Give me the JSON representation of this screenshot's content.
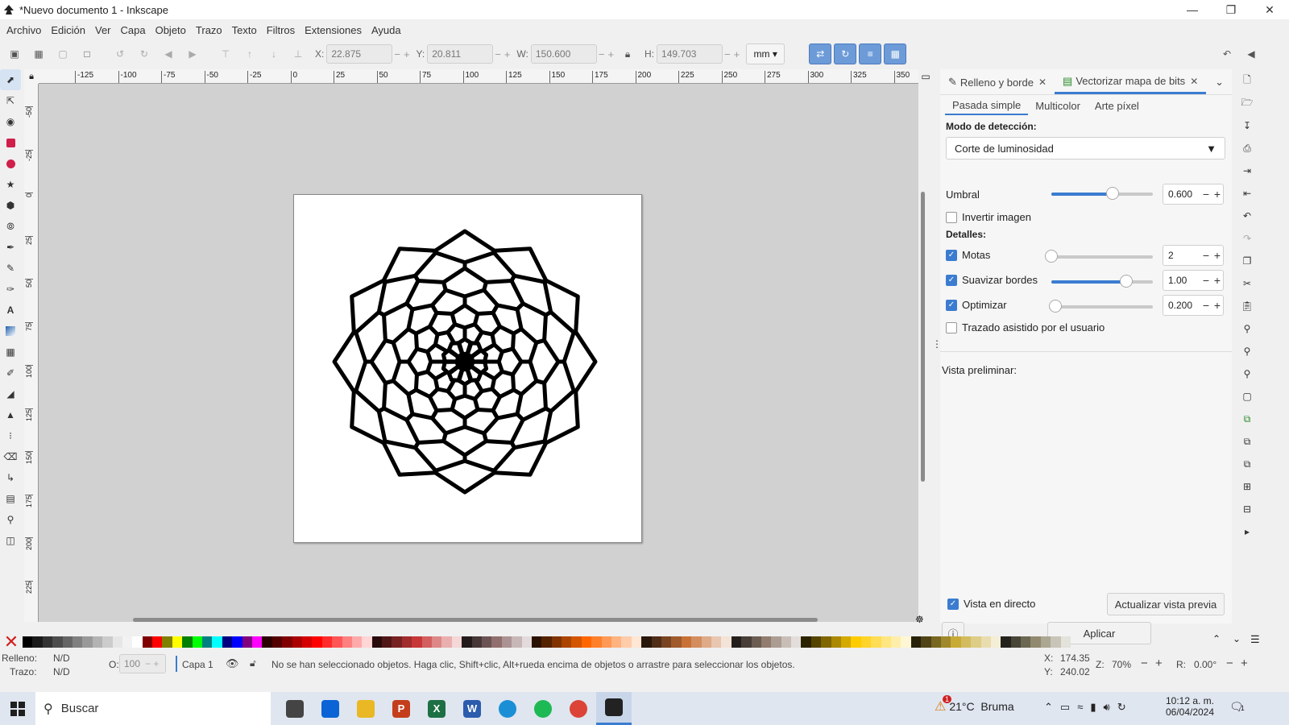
{
  "window": {
    "title": "*Nuevo documento 1 - Inkscape"
  },
  "menu": [
    "Archivo",
    "Edición",
    "Ver",
    "Capa",
    "Objeto",
    "Trazo",
    "Texto",
    "Filtros",
    "Extensiones",
    "Ayuda"
  ],
  "toolbar": {
    "x_label": "X:",
    "x_value": "22.875",
    "y_label": "Y:",
    "y_value": "20.811",
    "w_label": "W:",
    "w_value": "150.600",
    "h_label": "H:",
    "h_value": "149.703",
    "unit": "mm"
  },
  "ruler": {
    "h_ticks": [
      "-125",
      "-100",
      "-75",
      "-50",
      "-25",
      "0",
      "25",
      "50",
      "75",
      "100",
      "125",
      "150",
      "175",
      "200",
      "225",
      "250",
      "275",
      "300",
      "325",
      "350"
    ],
    "v_ticks": [
      "-50",
      "-25",
      "0",
      "25",
      "50",
      "75",
      "100",
      "125",
      "150",
      "175",
      "200",
      "225"
    ]
  },
  "dock": {
    "tabs": [
      {
        "label": "Relleno y borde",
        "icon": "fill-stroke-icon"
      },
      {
        "label": "Vectorizar mapa de bits",
        "icon": "trace-bitmap-icon"
      }
    ],
    "subtabs": [
      "Pasada simple",
      "Multicolor",
      "Arte píxel"
    ],
    "mode_label": "Modo de detección:",
    "mode_value": "Corte de luminosidad",
    "threshold": {
      "label": "Umbral",
      "value": "0.600",
      "level": 0.6
    },
    "invert": {
      "label": "Invertir imagen",
      "checked": false
    },
    "details_label": "Detalles:",
    "details": [
      {
        "label": "Motas",
        "value": "2",
        "checked": true,
        "level": 0.0
      },
      {
        "label": "Suavizar bordes",
        "value": "1.00",
        "checked": true,
        "level": 0.74
      },
      {
        "label": "Optimizar",
        "value": "0.200",
        "checked": true,
        "level": 0.04
      }
    ],
    "user_assisted": {
      "label": "Trazado asistido por el usuario",
      "checked": false
    },
    "preview_label": "Vista preliminar:",
    "live_preview": {
      "label": "Vista en directo",
      "checked": true
    },
    "update_preview": "Actualizar vista previa",
    "apply": "Aplicar"
  },
  "status": {
    "fill_label": "Relleno:",
    "fill_value": "N/D",
    "stroke_label": "Trazo:",
    "stroke_value": "N/D",
    "opacity_label": "O:",
    "opacity_value": "100",
    "layer": "Capa 1",
    "message": "No se han seleccionado objetos. Haga clic, Shift+clic, Alt+rueda encima de objetos o arrastre para seleccionar los objetos.",
    "cursor_x_label": "X:",
    "cursor_x": "174.35",
    "cursor_y_label": "Y:",
    "cursor_y": "240.02",
    "zoom_label": "Z:",
    "zoom": "70%",
    "rotation_label": "R:",
    "rotation": "0.00°"
  },
  "taskbar": {
    "search": "Buscar",
    "weather": "21°C  Bruma",
    "weather_badge": "1",
    "time": "10:12 a. m.",
    "date": "06/04/2024",
    "notif_count": "1",
    "apps": [
      {
        "name": "task-view",
        "letter": "",
        "color": "#444"
      },
      {
        "name": "mail",
        "letter": "",
        "color": "#0a64d6"
      },
      {
        "name": "file-explorer",
        "letter": "",
        "color": "#e9b824"
      },
      {
        "name": "powerpoint",
        "letter": "P",
        "color": "#c43e1c"
      },
      {
        "name": "excel",
        "letter": "X",
        "color": "#1d7044"
      },
      {
        "name": "word",
        "letter": "W",
        "color": "#2b5cad"
      },
      {
        "name": "edge",
        "letter": "",
        "color": "#1a8fd6"
      },
      {
        "name": "spotify",
        "letter": "",
        "color": "#1db954"
      },
      {
        "name": "chrome",
        "letter": "",
        "color": "#db4437"
      },
      {
        "name": "inkscape",
        "letter": "",
        "color": "#222"
      }
    ]
  },
  "palette": [
    "#000000",
    "#1a1a1a",
    "#333333",
    "#4d4d4d",
    "#666666",
    "#808080",
    "#999999",
    "#b3b3b3",
    "#cccccc",
    "#e6e6e6",
    "#f2f2f2",
    "#ffffff",
    "#800000",
    "#ff0000",
    "#808000",
    "#ffff00",
    "#008000",
    "#00ff00",
    "#008080",
    "#00ffff",
    "#000080",
    "#0000ff",
    "#800080",
    "#ff00ff",
    "#2b0000",
    "#550000",
    "#800000",
    "#aa0000",
    "#d40000",
    "#ff0000",
    "#ff2a2a",
    "#ff5555",
    "#ff8080",
    "#ffaaaa",
    "#ffd5d5",
    "#280b0b",
    "#501616",
    "#782121",
    "#a02c2c",
    "#c83737",
    "#d35f5f",
    "#de8787",
    "#e9afaf",
    "#f4d7d7",
    "#241c1c",
    "#483737",
    "#6c5353",
    "#916f6f",
    "#ac9393",
    "#c8b7b7",
    "#e3dbdb",
    "#2b1100",
    "#552200",
    "#803300",
    "#aa4400",
    "#d45500",
    "#ff6600",
    "#ff7f2a",
    "#ff9955",
    "#ffb380",
    "#ffccaa",
    "#ffe6d5",
    "#28170b",
    "#502d16",
    "#784421",
    "#a05a2c",
    "#c87137",
    "#d38d5f",
    "#deaa87",
    "#e9c6af",
    "#f4e3d7",
    "#241f1c",
    "#483e37",
    "#6c5d53",
    "#917c6f",
    "#ac9d93",
    "#c8beb7",
    "#e3dedb",
    "#2b2200",
    "#554400",
    "#806600",
    "#aa8800",
    "#d4aa00",
    "#ffcc00",
    "#ffd42a",
    "#ffdd55",
    "#ffe680",
    "#ffeeaa",
    "#fff6d5",
    "#28220b",
    "#504416",
    "#786721",
    "#a0892c",
    "#c8ab37",
    "#d3bc5f",
    "#decd87",
    "#e9ddaf",
    "#f4eed7",
    "#24221c",
    "#484537",
    "#6c6753",
    "#918a6f",
    "#aca793",
    "#c8c4b7",
    "#e3e2db"
  ]
}
